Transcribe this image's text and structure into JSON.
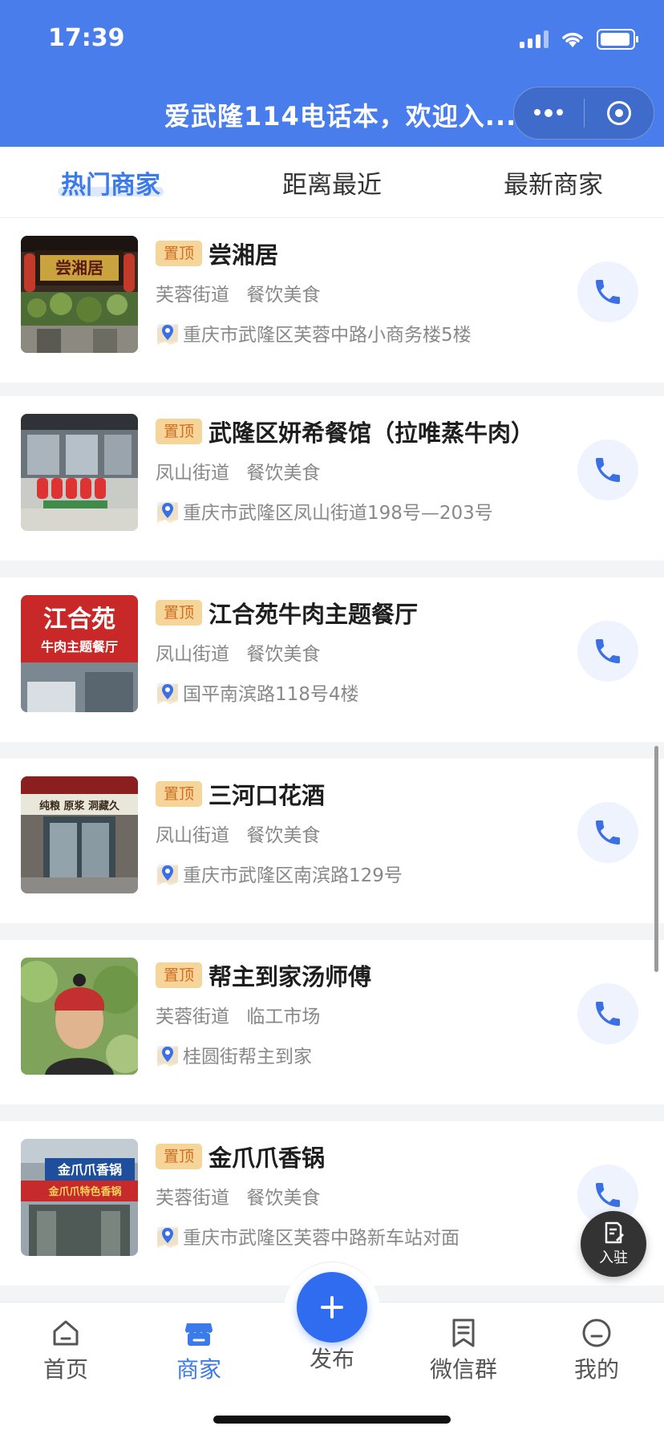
{
  "status_bar": {
    "time": "17:39"
  },
  "nav": {
    "title": "爱武隆114电话本，欢迎入..."
  },
  "tabs": [
    {
      "label": "热门商家",
      "active": true
    },
    {
      "label": "距离最近",
      "active": false
    },
    {
      "label": "最新商家",
      "active": false
    }
  ],
  "merchants": [
    {
      "badge": "置顶",
      "name": "尝湘居",
      "district": "芙蓉街道",
      "category": "餐饮美食",
      "address": "重庆市武隆区芙蓉中路小商务楼5楼"
    },
    {
      "badge": "置顶",
      "name": "武隆区妍希餐馆（拉唯蒸牛肉）",
      "district": "凤山街道",
      "category": "餐饮美食",
      "address": "重庆市武隆区凤山街道198号—203号"
    },
    {
      "badge": "置顶",
      "name": "江合苑牛肉主题餐厅",
      "district": "凤山街道",
      "category": "餐饮美食",
      "address": "国平南滨路118号4楼"
    },
    {
      "badge": "置顶",
      "name": "三河口花酒",
      "district": "凤山街道",
      "category": "餐饮美食",
      "address": "重庆市武隆区南滨路129号"
    },
    {
      "badge": "置顶",
      "name": "帮主到家汤师傅",
      "district": "芙蓉街道",
      "category": "临工市场",
      "address": "桂圆街帮主到家"
    },
    {
      "badge": "置顶",
      "name": "金爪爪香锅",
      "district": "芙蓉街道",
      "category": "餐饮美食",
      "address": "重庆市武隆区芙蓉中路新车站对面"
    }
  ],
  "thumb_text": {
    "m0": "尝湘居",
    "m2_line1": "江合苑",
    "m2_line2": "牛肉主题餐厅",
    "m3": "纯粮 原浆 洞藏久",
    "m5_line1": "金爪爪香锅",
    "m5_line2": "金爪爪特色香锅"
  },
  "fab": {
    "label": "入驻"
  },
  "bottom_nav": {
    "home": "首页",
    "merchants": "商家",
    "publish": "发布",
    "wechat_group": "微信群",
    "mine": "我的"
  },
  "colors": {
    "primary": "#4a7dec",
    "badge_bg": "#f5d59a",
    "badge_text": "#d86b1d"
  }
}
